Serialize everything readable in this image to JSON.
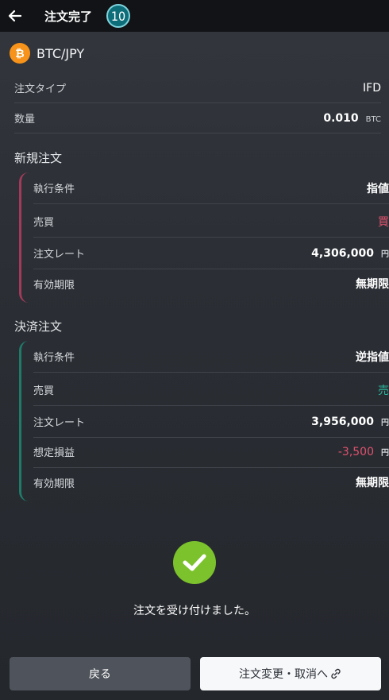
{
  "header": {
    "title": "注文完了",
    "step": "10"
  },
  "pair": {
    "name": "BTC/JPY",
    "coin_color": "#f7931a"
  },
  "summary": [
    {
      "label": "注文タイプ",
      "value": "IFD",
      "unit": ""
    },
    {
      "label": "数量",
      "value": "0.010",
      "unit": "BTC"
    }
  ],
  "new_order": {
    "title": "新規注文",
    "accent": "#a23a5a",
    "rows": [
      {
        "label": "執行条件",
        "value": "指値",
        "unit": ""
      },
      {
        "label": "売買",
        "value": "買",
        "unit": ""
      },
      {
        "label": "注文レート",
        "value": "4,306,000",
        "unit": "円"
      },
      {
        "label": "有効期限",
        "value": "無期限",
        "unit": ""
      }
    ]
  },
  "settle_order": {
    "title": "決済注文",
    "accent": "#1f7a68",
    "rows": [
      {
        "label": "執行条件",
        "value": "逆指値",
        "unit": ""
      },
      {
        "label": "売買",
        "value": "売",
        "unit": ""
      },
      {
        "label": "注文レート",
        "value": "3,956,000",
        "unit": "円"
      },
      {
        "label": "想定損益",
        "value": "-3,500",
        "unit": "円"
      },
      {
        "label": "有効期限",
        "value": "無期限",
        "unit": ""
      }
    ]
  },
  "result": {
    "message": "注文を受け付けました。"
  },
  "buttons": {
    "back": "戻る",
    "change": "注文変更・取消へ"
  }
}
